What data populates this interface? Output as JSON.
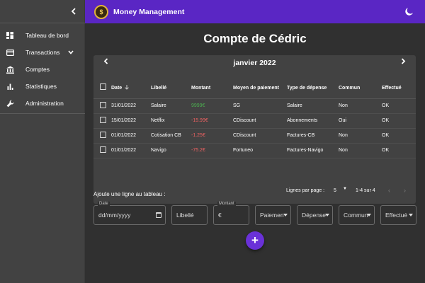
{
  "app": {
    "title": "Money Management",
    "logo_text": "$",
    "accent": "#5a26c4"
  },
  "sidebar": {
    "items": [
      {
        "label": "Tableau de bord",
        "icon": "dashboard-icon"
      },
      {
        "label": "Transactions",
        "icon": "credit-card-icon",
        "expandable": true
      },
      {
        "label": "Comptes",
        "icon": "bank-icon"
      },
      {
        "label": "Statistiques",
        "icon": "bar-chart-icon"
      },
      {
        "label": "Administration",
        "icon": "wrench-icon"
      }
    ]
  },
  "main": {
    "title": "Compte de Cédric",
    "month": "janvier 2022",
    "table": {
      "headers": {
        "date": "Date",
        "libelle": "Libellé",
        "montant": "Montant",
        "moyen": "Moyen de paiement",
        "type": "Type de dépense",
        "commun": "Commun",
        "effectue": "Effectué"
      },
      "rows": [
        {
          "date": "31/01/2022",
          "libelle": "Salaire",
          "montant": "9999€",
          "moyen": "SG",
          "type": "Salaire",
          "commun": "Non",
          "effectue": "OK"
        },
        {
          "date": "15/01/2022",
          "libelle": "Netflix",
          "montant": "-15.99€",
          "moyen": "CDiscount",
          "type": "Abonnements",
          "commun": "Oui",
          "effectue": "OK"
        },
        {
          "date": "01/01/2022",
          "libelle": "Cotisation CB",
          "montant": "-1.25€",
          "moyen": "CDiscount",
          "type": "Factures-CB",
          "commun": "Non",
          "effectue": "OK"
        },
        {
          "date": "01/01/2022",
          "libelle": "Navigo",
          "montant": "-75.2€",
          "moyen": "Fortuneo",
          "type": "Factures-Navigo",
          "commun": "Non",
          "effectue": "OK"
        }
      ]
    },
    "pager": {
      "rows_per_page_label": "Lignes par page :",
      "rows_per_page": "5",
      "range": "1-4 sur 4"
    },
    "add_form": {
      "heading": "Ajoute une ligne au tableau :",
      "date_label": "Date",
      "date_placeholder": "dd/mm/yyyy",
      "libelle_placeholder": "Libellé",
      "montant_label": "Montant",
      "montant_placeholder": "€",
      "paiement": "Paiemen",
      "depense": "Dépense",
      "commun": "Commun",
      "effectue": "Effectué",
      "add_symbol": "+"
    }
  },
  "colors": {
    "positive": "#4caf50",
    "negative": "#f06262",
    "background": "#303030",
    "sidebar": "#424242"
  }
}
